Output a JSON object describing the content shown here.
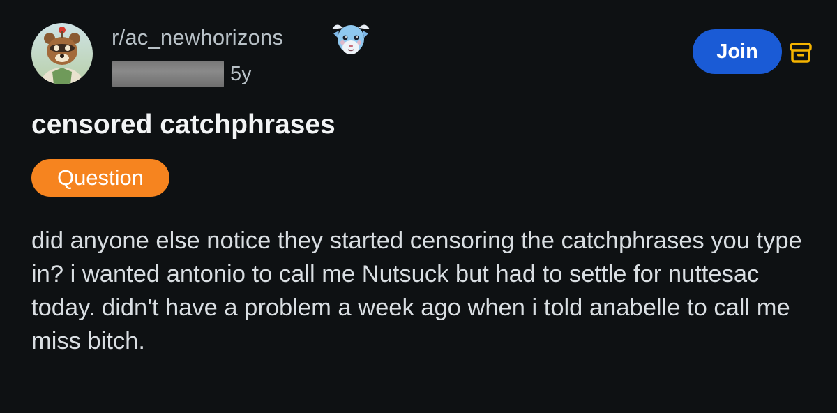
{
  "post": {
    "subreddit": "r/ac_newhorizons",
    "age": "5y",
    "join_label": "Join",
    "title": "censored catchphrases",
    "flair": "Question",
    "body": "did anyone else notice they started censoring the catchphrases you type in? i wanted antonio to call me Nutsuck but had to settle for nuttesac today. didn't have a problem a week ago when i told anabelle to call me miss bitch."
  },
  "icons": {
    "avatar": "tom-nook-avatar-icon",
    "user_flair": "villager-face-icon",
    "archive": "archive-icon"
  },
  "colors": {
    "background": "#0e1113",
    "join_button": "#1a5bd6",
    "flair": "#f6841f",
    "archive_icon": "#f5b400"
  }
}
